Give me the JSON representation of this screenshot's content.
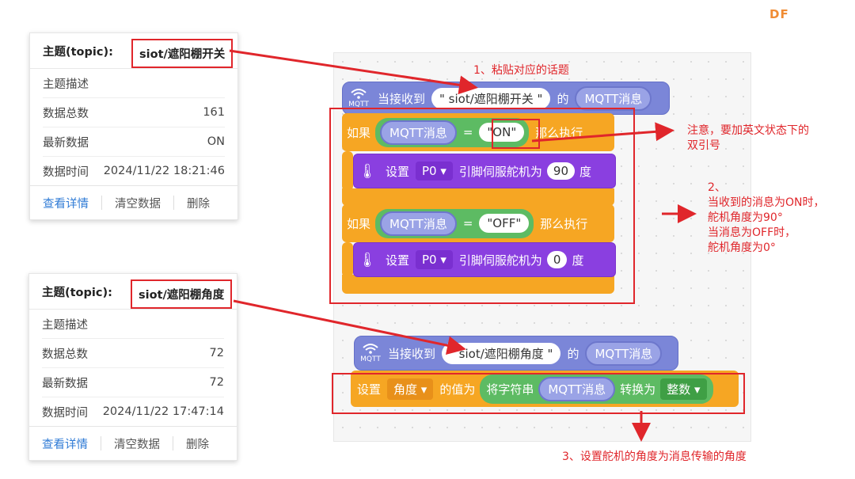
{
  "logo": "DF",
  "card1": {
    "topic_label": "主题(topic):",
    "topic_value": "siot/遮阳棚开关",
    "rows": [
      {
        "k": "主题描述",
        "v": ""
      },
      {
        "k": "数据总数",
        "v": "161"
      },
      {
        "k": "最新数据",
        "v": "ON"
      },
      {
        "k": "数据时间",
        "v": "2024/11/22 18:21:46"
      }
    ],
    "actions": [
      "查看详情",
      "清空数据",
      "删除"
    ]
  },
  "card2": {
    "topic_label": "主题(topic):",
    "topic_value": "siot/遮阳棚角度",
    "rows": [
      {
        "k": "主题描述",
        "v": ""
      },
      {
        "k": "数据总数",
        "v": "72"
      },
      {
        "k": "最新数据",
        "v": "72"
      },
      {
        "k": "数据时间",
        "v": "2024/11/22 17:47:14"
      }
    ],
    "actions": [
      "查看详情",
      "清空数据",
      "删除"
    ]
  },
  "blocks": {
    "evt1": {
      "mqtt": "MQTT",
      "prefix": "当接收到",
      "topic": "\" siot/遮阳棚开关 \"",
      "of": "的",
      "msg": "MQTT消息"
    },
    "if1": {
      "if": "如果",
      "msg": "MQTT消息",
      "eq": "=",
      "val": "\"ON\"",
      "then": "那么执行"
    },
    "set1": {
      "set": "设置",
      "pin": "P0 ▾",
      "text": "引脚伺服舵机为",
      "num": "90",
      "unit": "度"
    },
    "if2": {
      "if": "如果",
      "msg": "MQTT消息",
      "eq": "=",
      "val": "\"OFF\"",
      "then": "那么执行"
    },
    "set2": {
      "set": "设置",
      "pin": "P0 ▾",
      "text": "引脚伺服舵机为",
      "num": "0",
      "unit": "度"
    },
    "evt2": {
      "mqtt": "MQTT",
      "prefix": "当接收到",
      "topic": "\" siot/遮阳棚角度 \"",
      "of": "的",
      "msg": "MQTT消息"
    },
    "setvar": {
      "set": "设置",
      "var": "角度 ▾",
      "value": "的值为",
      "conv": "将字符串",
      "msg": "MQTT消息",
      "to": "转换为",
      "type": "整数 ▾"
    }
  },
  "notes": {
    "n1": "1、粘贴对应的话题",
    "n_quote_1": "注意，要加英文状态下的",
    "n_quote_2": "双引号",
    "n2_1": "2、",
    "n2_2": "当收到的消息为ON时，",
    "n2_3": "舵机角度为90°",
    "n2_4": "当消息为OFF时，",
    "n2_5": "舵机角度为0°",
    "n3": "3、设置舵机的角度为消息传输的角度"
  },
  "colors": {
    "accent_red": "#e0262b",
    "event": "#7b86d8",
    "control": "#f6a623",
    "servo": "#8a3fe0",
    "operator": "#5dbb63",
    "link": "#2f7bd6"
  }
}
